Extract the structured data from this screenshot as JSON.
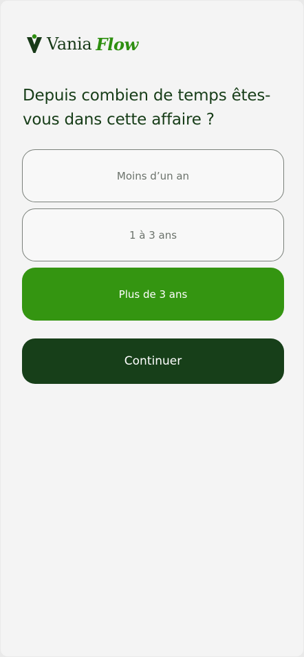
{
  "brand": {
    "name_part1": "Vania",
    "name_part2": "Flow",
    "icon": "person-v-logo-icon",
    "colors": {
      "dark_green": "#173f19",
      "bright_green": "#349511",
      "background": "#f4f4f4"
    }
  },
  "question": {
    "text": "Depuis combien de temps êtes-vous dans cette affaire ?"
  },
  "options": [
    {
      "label": "Moins d’un an",
      "selected": false
    },
    {
      "label": "1 à 3 ans",
      "selected": false
    },
    {
      "label": "Plus de 3 ans",
      "selected": true
    }
  ],
  "actions": {
    "continue_label": "Continuer"
  }
}
